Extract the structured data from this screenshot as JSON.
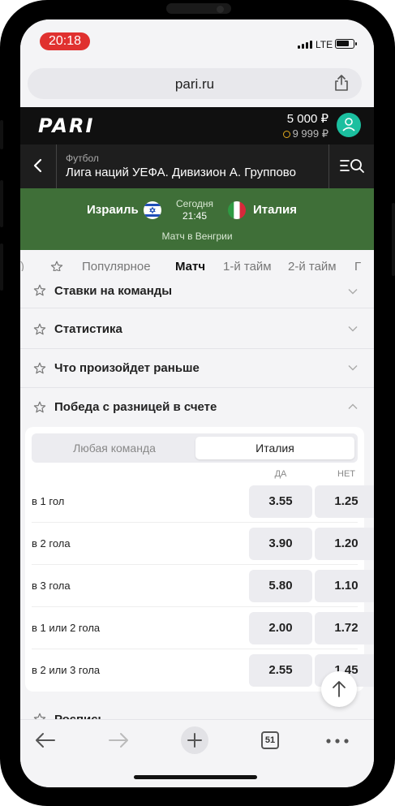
{
  "status": {
    "time": "20:18",
    "network": "LTE"
  },
  "browser": {
    "url": "pari.ru",
    "tab_count": "51"
  },
  "header": {
    "logo": "PARI",
    "balance": "5 000 ₽",
    "bonus": "9 999 ₽"
  },
  "breadcrumb": {
    "sport": "Футбол",
    "title": "Лига наций УЕФА. Дивизион А. Группово"
  },
  "match": {
    "home": "Израиль",
    "away": "Италия",
    "day": "Сегодня",
    "time": "21:45",
    "venue": "Матч в Венгрии"
  },
  "tabs": {
    "edge_left": ")",
    "items": [
      "Популярное",
      "Матч",
      "1-й тайм",
      "2-й тайм",
      "Г"
    ],
    "active": "Матч"
  },
  "sections": [
    {
      "label": "Ставки на команды",
      "expanded": false
    },
    {
      "label": "Статистика",
      "expanded": false
    },
    {
      "label": "Что произойдет раньше",
      "expanded": false
    },
    {
      "label": "Победа с разницей в счете",
      "expanded": true
    }
  ],
  "margin_market": {
    "options": [
      "Любая команда",
      "Италия"
    ],
    "selected": "Италия",
    "columns": [
      "ДА",
      "НЕТ"
    ],
    "rows": [
      {
        "label": "в 1 гол",
        "yes": "3.55",
        "no": "1.25"
      },
      {
        "label": "в 2 гола",
        "yes": "3.90",
        "no": "1.20"
      },
      {
        "label": "в 3 гола",
        "yes": "5.80",
        "no": "1.10"
      },
      {
        "label": "в 1 или 2 гола",
        "yes": "2.00",
        "no": "1.72"
      },
      {
        "label": "в 2 или 3 гола",
        "yes": "2.55",
        "no": "1.45"
      }
    ]
  },
  "next_section": {
    "label": "Роспись"
  },
  "colors": {
    "accent": "#2bb673",
    "match_bg": "#3f6f38",
    "time_pill": "#e0312f",
    "avatar": "#1bbf9f"
  }
}
